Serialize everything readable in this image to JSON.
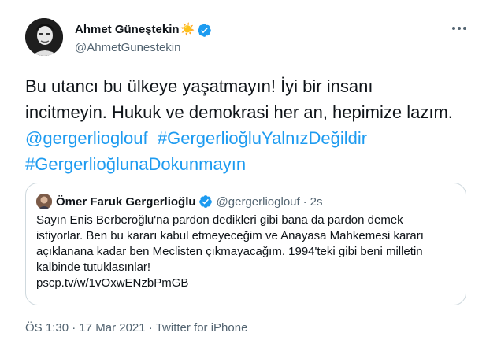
{
  "author": {
    "display_name": "Ahmet Güneştekin",
    "name_emoji": "☀️",
    "handle": "@AhmetGunestekin"
  },
  "tweet": {
    "lines": [
      "Bu utancı bu ülkeye yaşatmayın! İyi bir insanı",
      "incitmeyin. Hukuk ve demokrasi her an, hepimize lazım."
    ],
    "mention": "@gergerlioglouf",
    "hashtags": [
      "#GergerlioğluYalnızDeğildir",
      "#GergerlioğlunaDokunmayın"
    ]
  },
  "quoted": {
    "display_name": "Ömer Faruk Gergerlioğlu",
    "handle": "@gergerlioglouf",
    "separator": "·",
    "time": "2s",
    "lines": [
      "Sayın Enis Berberoğlu'na pardon dedikleri gibi bana da pardon demek",
      "istiyorlar. Ben bu kararı kabul etmeyeceğim ve Anayasa Mahkemesi kararı",
      "açıklanana kadar ben Meclisten çıkmayacağım. 1994'teki gibi beni milletin",
      "kalbinde tutuklasınlar!",
      "pscp.tv/w/1vOxwENzbPmGB"
    ]
  },
  "meta": {
    "time": "ÖS 1:30",
    "separator": "·",
    "date": "17 Mar 2021",
    "source": "Twitter for iPhone"
  },
  "colors": {
    "link": "#1d9bf0",
    "secondary_text": "#536471",
    "border": "#cfd9de",
    "verified": "#1d9bf0"
  },
  "icons": {
    "verified": "verified-badge-icon",
    "more": "more-options-icon"
  }
}
